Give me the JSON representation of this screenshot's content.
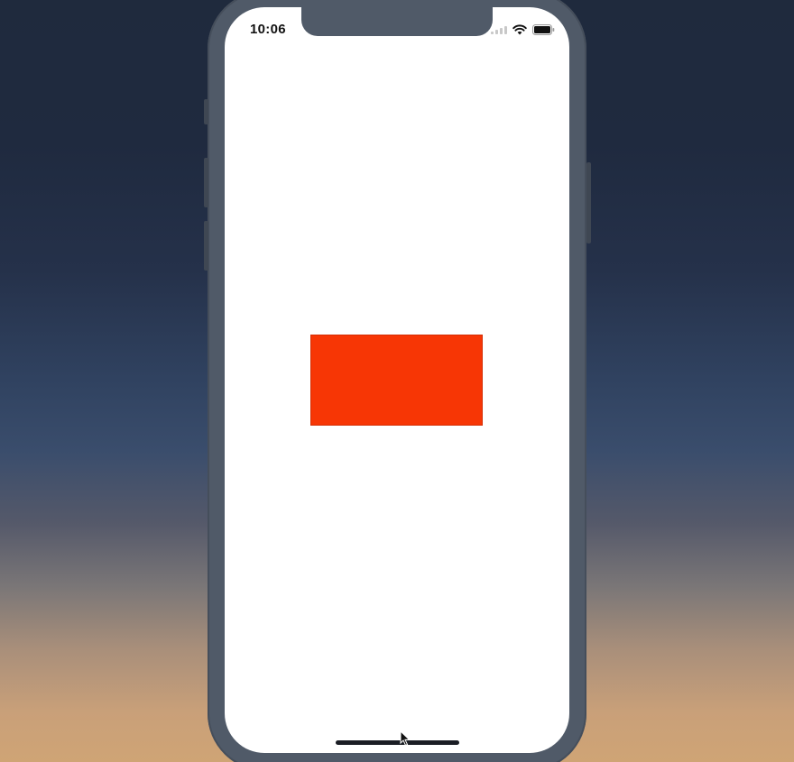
{
  "status_bar": {
    "time": "10:06",
    "icons": [
      "cellular-signal-icon",
      "wifi-icon",
      "battery-icon"
    ]
  },
  "content": {
    "block_color": "#f73605"
  },
  "colors": {
    "phone_frame": "#505a68",
    "screen_background": "#ffffff",
    "home_indicator": "#1a1d24"
  }
}
